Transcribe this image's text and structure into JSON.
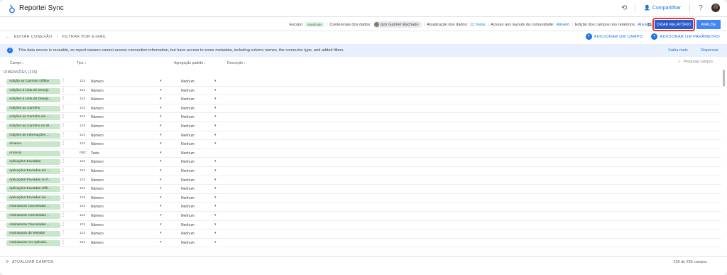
{
  "app": {
    "title": "Reportei Sync"
  },
  "topbar": {
    "share_label": "Compartilhar",
    "history_icon": "history-icon",
    "help_icon": "help-icon"
  },
  "info": {
    "scope_label": "Escopo",
    "scope_value": "Atualizado",
    "credentials_label": "Credenciais dos dados:",
    "credentials_user": "Igor Gabriel Machado",
    "update_label": "Atualização dos dados:",
    "update_value": "12 horas",
    "community_label": "Acesso aos layouts da comunidade:",
    "community_value": "Ativado",
    "edit_label": "Edição dos campos nos relatórios:",
    "edit_value": "Ativado"
  },
  "buttons": {
    "create_report": "CRIAR RELATÓRIO",
    "analysis": "ANÁLISE"
  },
  "toolbar": {
    "edit_connection": "EDITAR CONEXÃO",
    "filter_email": "FILTRAR POR E-MAIL",
    "add_field": "ADICIONAR UM CAMPO",
    "add_parameter": "ADICIONAR UM PARÂMETRO"
  },
  "banner": {
    "message": "This data source is reusable, so report viewers cannot access connection information, but have access to some metadata, including column names, the connector type, and added filters.",
    "learn_more": "Saiba mais",
    "dismiss": "Dispensar"
  },
  "table": {
    "headers": {
      "field": "Campo",
      "type": "Tipo",
      "aggregation": "Agregação padrão",
      "description": "Descrição"
    },
    "search_placeholder": "Pesquisar campos",
    "dimensions_label": "DIMENSÕES (239)",
    "rows": [
      {
        "name": "Adição ao Carrinho Offline",
        "type_icon": "123",
        "type": "Número",
        "agg": "Nenhum"
      },
      {
        "name": "Adições à Lista de Desejo",
        "type_icon": "123",
        "type": "Número",
        "agg": "Nenhum"
      },
      {
        "name": "Adições à Lista de Desejo...",
        "type_icon": "123",
        "type": "Número",
        "agg": "Nenhum"
      },
      {
        "name": "Adições ao Carrinho",
        "type_icon": "123",
        "type": "Número",
        "agg": "Nenhum"
      },
      {
        "name": "Adições ao Carrinho em ...",
        "type_icon": "123",
        "type": "Número",
        "agg": "Nenhum"
      },
      {
        "name": "Adições ao Carrinho no W...",
        "type_icon": "123",
        "type": "Número",
        "agg": "Nenhum"
      },
      {
        "name": "Adições de Informações ...",
        "type_icon": "123",
        "type": "Número",
        "agg": "Nenhum"
      },
      {
        "name": "Alcance",
        "type_icon": "123",
        "type": "Número",
        "agg": "Nenhum"
      },
      {
        "name": "Anúncio",
        "type_icon": "RBC",
        "type": "Texto",
        "agg": "Nenhum"
      },
      {
        "name": "Aplicações Enviadas",
        "type_icon": "123",
        "type": "Número",
        "agg": "Nenhum"
      },
      {
        "name": "Aplicações Enviadas em ...",
        "type_icon": "123",
        "type": "Número",
        "agg": "Nenhum"
      },
      {
        "name": "Aplicações Enviadas no F...",
        "type_icon": "123",
        "type": "Número",
        "agg": "Nenhum"
      },
      {
        "name": "Aplicações Enviadas Offli...",
        "type_icon": "123",
        "type": "Número",
        "agg": "Nenhum"
      },
      {
        "name": "Aplicações Enviadas via ...",
        "type_icon": "123",
        "type": "Número",
        "agg": "Nenhum"
      },
      {
        "name": "Assinaturas Canceladas ...",
        "type_icon": "123",
        "type": "Número",
        "agg": "Nenhum"
      },
      {
        "name": "Assinaturas Canceladas ...",
        "type_icon": "123",
        "type": "Número",
        "agg": "Nenhum"
      },
      {
        "name": "Assinaturas Canceladas ...",
        "type_icon": "123",
        "type": "Número",
        "agg": "Nenhum"
      },
      {
        "name": "Assinaturas do Website",
        "type_icon": "123",
        "type": "Número",
        "agg": "Nenhum"
      },
      {
        "name": "Assinaturas em Aplicativ...",
        "type_icon": "123",
        "type": "Número",
        "agg": "Nenhum"
      }
    ]
  },
  "footer": {
    "refresh_label": "ATUALIZAR CAMPOS",
    "count": "239 de 239 campos"
  }
}
